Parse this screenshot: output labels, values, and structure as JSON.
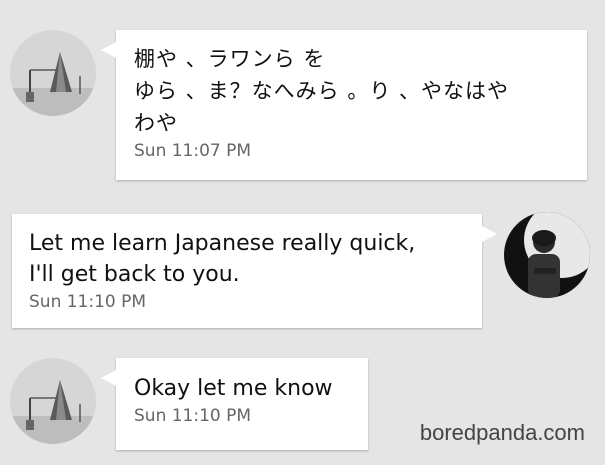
{
  "conversation": {
    "messages": [
      {
        "sender": "contact",
        "text": "棚や 、ラワンら を\nゆら 、ま？なへみら 。り 、やなはや\nわや",
        "time": "Sun 11:07 PM"
      },
      {
        "sender": "me",
        "text": "Let me learn Japanese really quick,\nI'll get back to you.",
        "time": "Sun 11:10 PM"
      },
      {
        "sender": "contact",
        "text": "Okay let me know",
        "time": "Sun 11:10 PM"
      }
    ]
  },
  "watermark": "boredpanda.com",
  "colors": {
    "background": "#e5e5e5",
    "bubble": "#ffffff",
    "text": "#111111",
    "timestamp": "#666666"
  },
  "icons": {
    "contact_avatar": "contact-avatar-photo",
    "my_avatar": "my-avatar-photo"
  }
}
